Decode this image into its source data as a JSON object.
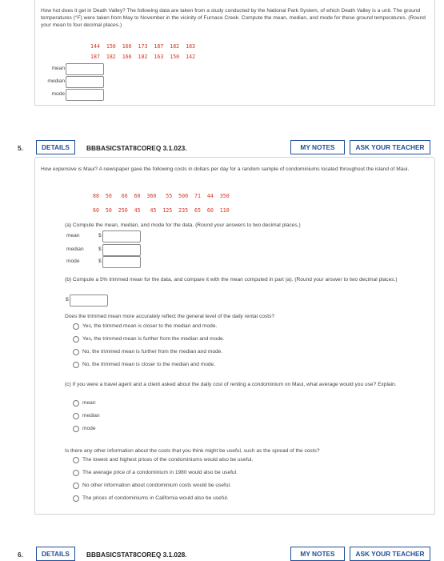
{
  "q4": {
    "prompt": "How hot does it get in Death Valley? The following data are taken from a study conducted by the National Park System, of which Death Valley is a unit. The ground temperatures (°F) were taken from May to November in the vicinity of Furnace Creek. Compute the mean, median, and mode for these ground temperatures. (Round your mean to four decimal places.)",
    "data_row1": "144  150  166  173  187  182  183",
    "data_row2": "187  182  166  182  163  150  142",
    "labels": {
      "mean": "mean",
      "median": "median",
      "mode": "mode"
    },
    "values": {
      "mean": "",
      "median": "",
      "mode": ""
    }
  },
  "q5": {
    "number": "5.",
    "details_label": "DETAILS",
    "code": "BBBASICSTAT8COREQ 3.1.023.",
    "my_notes_label": "MY NOTES",
    "ask_teacher_label": "ASK YOUR TEACHER",
    "prompt": "How expensive is Maui? A newspaper gave the following costs in dollars per day for a random sample of condominiums located throughout the island of Maui.",
    "data_row1": "88  50   66  60  360   55  500  71  44  350",
    "data_row2": "60  50  250  45   45  125  235  65  60  110",
    "part_a": "(a) Compute the mean, median, and mode for the data. (Round your answers to two decimal places.)",
    "labels": {
      "mean": "mean",
      "median": "median",
      "mode": "mode",
      "currency": "$"
    },
    "values": {
      "mean": "",
      "median": "",
      "mode": "",
      "trimmed": ""
    },
    "part_b": "(b) Compute a 5% trimmed mean for the data, and compare it with the mean computed in part (a). (Round your answer to two decimal places.)",
    "trimmed_question": "Does the trimmed mean more accurately reflect the general level of the daily rental costs?",
    "trimmed_options": [
      "Yes, the trimmed mean is closer to the median and mode.",
      "Yes, the trimmed mean is further from the median and mode.",
      "No, the trimmed mean is further from the median and mode.",
      "No, the trimmed mean is closer to the median and mode."
    ],
    "part_c": "(c) If you were a travel agent and a client asked about the daily cost of renting a condominium on Maui, what average would you use? Explain.",
    "average_options": [
      "mean",
      "median",
      "mode"
    ],
    "other_question": "Is there any other information about the costs that you think might be useful, such as the spread of the costs?",
    "other_options": [
      "The lowest and highest prices of the condominiums would also be useful.",
      "The average price of a condominium in 1980 would also be useful.",
      "No other information about condominium costs would be useful.",
      "The prices of condominiums in California would also be useful."
    ]
  },
  "q6": {
    "number": "6.",
    "details_label": "DETAILS",
    "code": "BBBASICSTAT8COREQ 3.1.028.",
    "my_notes_label": "MY NOTES",
    "ask_teacher_label": "ASK YOUR TEACHER"
  },
  "colors": {
    "accent": "#1f4f9a",
    "data_red": "#d9351e",
    "border": "#d4d4d4"
  }
}
